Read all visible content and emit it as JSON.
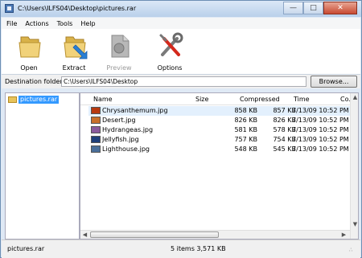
{
  "window": {
    "title": "C:\\Users\\ILFS04\\Desktop\\pictures.rar"
  },
  "menu": [
    "File",
    "Actions",
    "Tools",
    "Help"
  ],
  "toolbar": {
    "open": {
      "label": "Open",
      "icon": "folder-open-icon"
    },
    "extract": {
      "label": "Extract",
      "icon": "extract-icon"
    },
    "preview": {
      "label": "Preview",
      "icon": "preview-icon",
      "disabled": true
    },
    "options": {
      "label": "Options",
      "icon": "tools-icon"
    }
  },
  "destination": {
    "label": "Destination folder:",
    "value": "C:\\Users\\ILFS04\\Desktop",
    "browse_label": "Browse..."
  },
  "tree": {
    "item": "pictures.rar"
  },
  "columns": {
    "name": "Name",
    "size": "Size",
    "compressed": "Compressed",
    "time": "Time",
    "comment": "Co..."
  },
  "files": [
    {
      "name": "Chrysanthemum.jpg",
      "size": "858 KB",
      "compressed": "857 KB",
      "time": "7/13/09 10:52 PM",
      "thumb": "#b83a10"
    },
    {
      "name": "Desert.jpg",
      "size": "826 KB",
      "compressed": "826 KB",
      "time": "7/13/09 10:52 PM",
      "thumb": "#c8702a"
    },
    {
      "name": "Hydrangeas.jpg",
      "size": "581 KB",
      "compressed": "578 KB",
      "time": "7/13/09 10:52 PM",
      "thumb": "#8a5a9c"
    },
    {
      "name": "Jellyfish.jpg",
      "size": "757 KB",
      "compressed": "754 KB",
      "time": "7/13/09 10:52 PM",
      "thumb": "#1e3f7a"
    },
    {
      "name": "Lighthouse.jpg",
      "size": "548 KB",
      "compressed": "545 KB",
      "time": "7/13/09 10:52 PM",
      "thumb": "#4a6f9a"
    }
  ],
  "status": {
    "archive": "pictures.rar",
    "summary": "5 items  3,571 KB"
  }
}
